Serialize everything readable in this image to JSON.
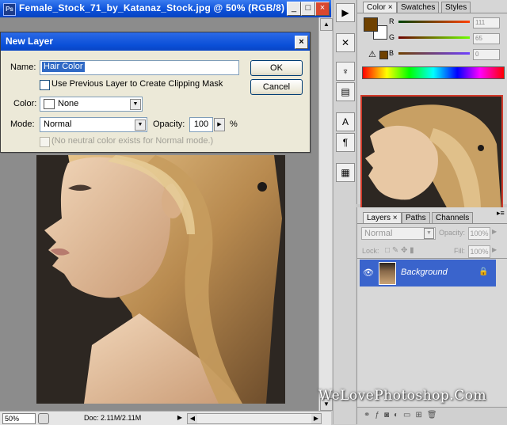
{
  "document": {
    "title": "Female_Stock_71_by_Katanaz_Stock.jpg @ 50% (RGB/8)",
    "ps_icon": "Ps",
    "minimize": "_",
    "maximize": "□",
    "close": "×",
    "zoom": "50%",
    "doc_info": "Doc: 2.11M/2.11M"
  },
  "dialog": {
    "title": "New Layer",
    "close": "×",
    "name_label": "Name:",
    "name_value": "Hair Color",
    "clip_mask_label": "Use Previous Layer to Create Clipping Mask",
    "color_label": "Color:",
    "color_value": "None",
    "mode_label": "Mode:",
    "mode_value": "Normal",
    "opacity_label": "Opacity:",
    "opacity_value": "100",
    "opacity_unit": "%",
    "neutral_label": "(No neutral color exists for Normal mode.)",
    "ok_label": "OK",
    "cancel_label": "Cancel"
  },
  "color_panel": {
    "tabs": [
      "Color",
      "Swatches",
      "Styles"
    ],
    "tab_close": "×",
    "r_label": "R",
    "g_label": "G",
    "b_label": "B",
    "r_value": "111",
    "g_value": "65",
    "b_value": "0",
    "foreground_color": "#6f4100",
    "background_color": "#ffffff",
    "warning_icon": "⚠"
  },
  "layers_panel": {
    "tabs": [
      "Layers",
      "Paths",
      "Channels"
    ],
    "tab_close": "×",
    "blend_mode": "Normal",
    "opacity_label": "Opacity:",
    "opacity_value": "100%",
    "lock_label": "Lock:",
    "fill_label": "Fill:",
    "fill_value": "100%",
    "layer_name": "Background"
  },
  "watermark": "WeLovePhotoshop.Com"
}
